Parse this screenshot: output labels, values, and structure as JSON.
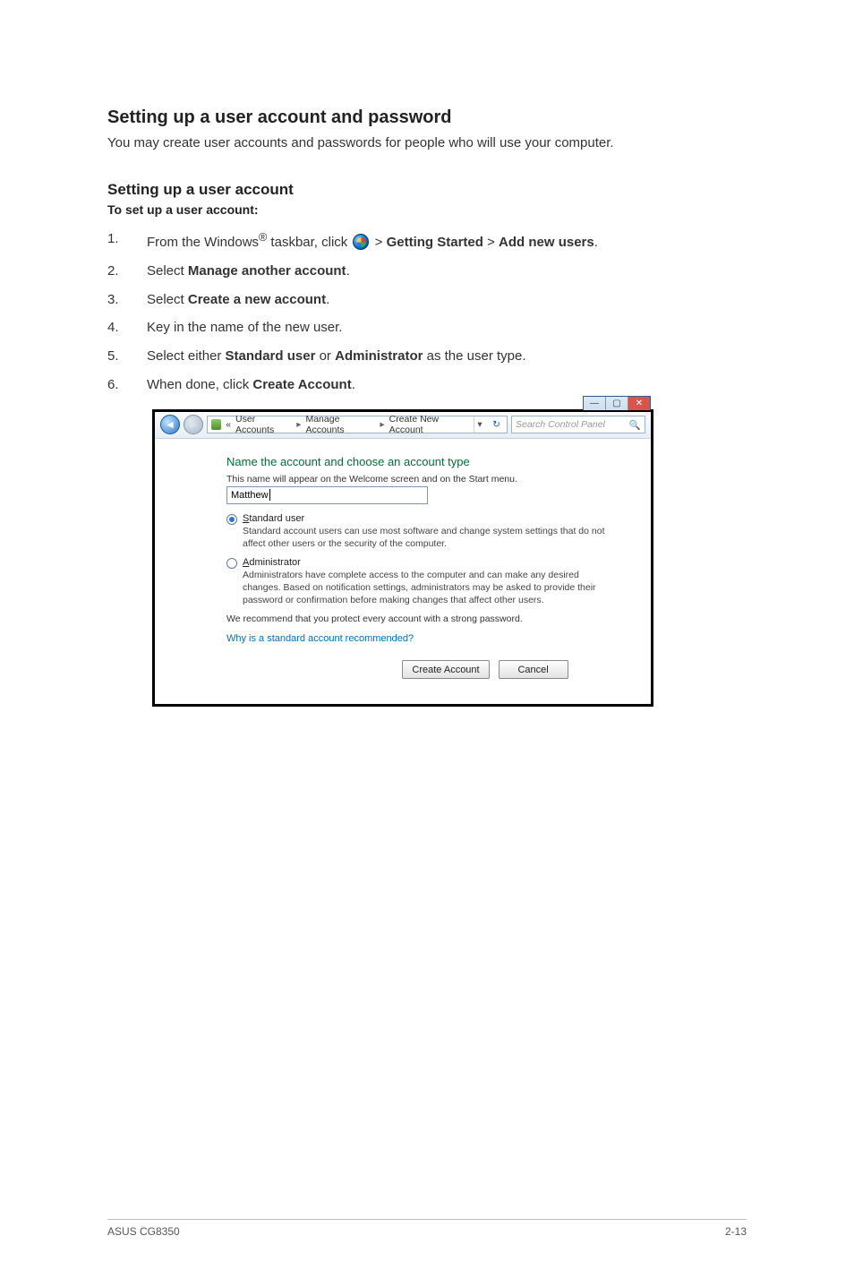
{
  "heading_main": "Setting up a user account and password",
  "intro": "You may create user accounts and passwords for people who will use your computer.",
  "heading_sub": "Setting up a user account",
  "lead": "To set up a user account:",
  "steps": {
    "s1_a": "From the Windows",
    "s1_sup": "®",
    "s1_b": " taskbar, click ",
    "s1_c": " > ",
    "s1_bold1": "Getting Started",
    "s1_d": " > ",
    "s1_bold2": "Add new users",
    "s1_e": ".",
    "s2_a": "Select ",
    "s2_bold": "Manage another account",
    "s2_b": ".",
    "s3_a": "Select ",
    "s3_bold": "Create a new account",
    "s3_b": ".",
    "s4": "Key in the name of the new user.",
    "s5_a": "Select either ",
    "s5_bold1": "Standard user",
    "s5_b": " or ",
    "s5_bold2": "Administrator",
    "s5_c": " as the user type.",
    "s6_a": "When done, click ",
    "s6_bold": "Create Account",
    "s6_b": "."
  },
  "step_numbers": {
    "n1": "1.",
    "n2": "2.",
    "n3": "3.",
    "n4": "4.",
    "n5": "5.",
    "n6": "6."
  },
  "window": {
    "titlebar": {
      "min": "—",
      "max": "▢",
      "close": "✕"
    },
    "nav": {
      "back": "◄",
      "forward": "►"
    },
    "breadcrumb": {
      "pre": "«",
      "c1": "User Accounts",
      "sep": "▸",
      "c2": "Manage Accounts",
      "c3": "Create New Account",
      "dd": "▾",
      "refresh": "↻"
    },
    "search": {
      "placeholder": "Search Control Panel",
      "icon": "🔍"
    },
    "content": {
      "title": "Name the account and choose an account type",
      "hint": "This name will appear on the Welcome screen and on the Start menu.",
      "name_value": "Matthew",
      "opt_std": {
        "label_u": "S",
        "label_rest": "tandard user",
        "desc": "Standard account users can use most software and change system settings that do not affect other users or the security of the computer."
      },
      "opt_admin": {
        "label_u": "A",
        "label_rest": "dministrator",
        "desc": "Administrators have complete access to the computer and can make any desired changes. Based on notification settings, administrators may be asked to provide their password or confirmation before making changes that affect other users."
      },
      "rec_line": "We recommend that you protect every account with a strong password.",
      "link": "Why is a standard account recommended?",
      "btn_create": "Create Account",
      "btn_cancel": "Cancel"
    }
  },
  "footer": {
    "left": "ASUS CG8350",
    "right": "2-13"
  }
}
